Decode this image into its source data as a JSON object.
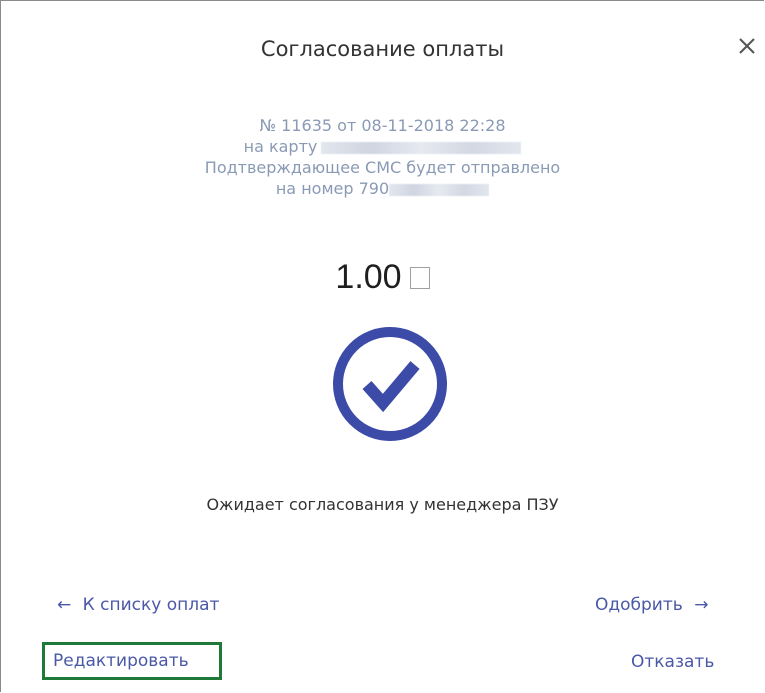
{
  "dialog": {
    "title": "Согласование оплаты",
    "close_icon": "close-icon"
  },
  "info": {
    "line1": "№ 11635 от 08-11-2018 22:28",
    "line2_prefix": "на карту",
    "line3": "Подтверждающее СМС будет отправлено",
    "line4_prefix": "на номер 790"
  },
  "amount": {
    "value": "1.00"
  },
  "status": {
    "icon": "checkmark-circle-icon",
    "text": "Ожидает согласования у менеджера ПЗУ"
  },
  "actions": {
    "back_arrow": "←",
    "back_label": "К списку оплат",
    "approve_label": "Одобрить",
    "approve_arrow": "→",
    "edit_label": "Редактировать",
    "reject_label": "Отказать"
  },
  "colors": {
    "accent": "#3c4ba8",
    "link": "#4a58a8",
    "info_text": "#8a9ab5",
    "highlight_border": "#1f7a3a"
  }
}
